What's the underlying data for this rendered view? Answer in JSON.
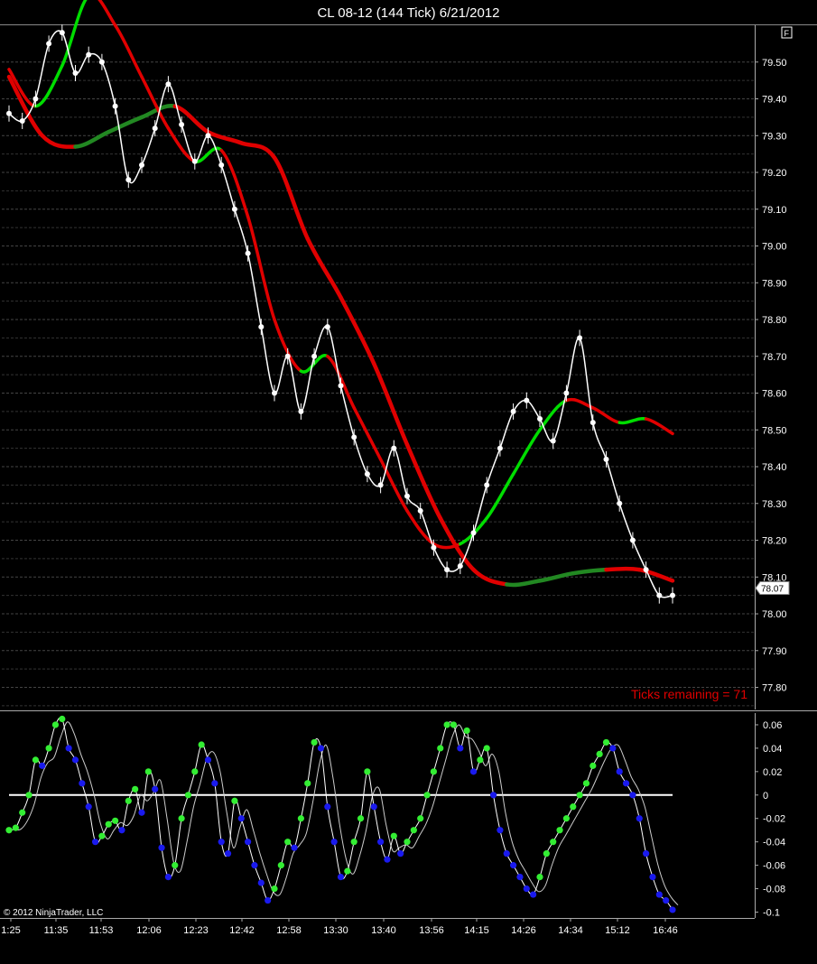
{
  "title": "CL 08-12 (144 Tick)  6/21/2012",
  "flag_label": "F",
  "copyright": "© 2012 NinjaTrader, LLC",
  "ticks_remaining": "Ticks remaining = 71",
  "last_price_label": "78.07",
  "colors": {
    "background": "#000000",
    "price": "#ffffff",
    "ma_red": "#e00000",
    "ma_green": "#00dd00",
    "ma_darkgreen": "#228822",
    "osc_green": "#33ee33",
    "osc_blue": "#1a1aee",
    "zero_line": "#ffffff",
    "ticks_text": "#e00000"
  },
  "chart_data": [
    {
      "type": "line",
      "title": "CL 08-12 (144 Tick)  6/21/2012",
      "y_axis_side": "right",
      "ylim": [
        77.74,
        79.6
      ],
      "yticks": [
        "79.50",
        "79.40",
        "79.30",
        "79.20",
        "79.10",
        "79.00",
        "78.90",
        "78.80",
        "78.70",
        "78.60",
        "78.50",
        "78.40",
        "78.30",
        "78.20",
        "78.10",
        "78.00",
        "77.90",
        "77.80"
      ],
      "ytick_values": [
        79.5,
        79.4,
        79.3,
        79.2,
        79.1,
        79.0,
        78.9,
        78.8,
        78.7,
        78.6,
        78.5,
        78.4,
        78.3,
        78.2,
        78.1,
        78.0,
        77.9,
        77.8
      ],
      "last_price": 78.07,
      "series": [
        {
          "style": "price",
          "x": [
            0,
            2,
            4,
            6,
            8,
            10,
            12,
            14,
            16,
            18,
            20,
            22,
            24,
            26,
            28,
            30,
            32,
            34,
            36,
            38,
            40,
            42,
            44,
            46,
            48,
            50,
            52,
            54,
            56,
            58,
            60,
            62,
            64,
            66,
            68,
            70,
            72,
            74,
            76,
            78,
            80,
            82,
            84,
            86,
            88,
            90,
            92,
            94,
            96,
            98,
            100
          ],
          "values": [
            79.36,
            79.34,
            79.4,
            79.55,
            79.58,
            79.47,
            79.52,
            79.5,
            79.38,
            79.18,
            79.22,
            79.32,
            79.44,
            79.33,
            79.23,
            79.3,
            79.22,
            79.1,
            78.98,
            78.78,
            78.6,
            78.7,
            78.55,
            78.7,
            78.78,
            78.62,
            78.48,
            78.38,
            78.35,
            78.45,
            78.32,
            78.28,
            78.18,
            78.12,
            78.13,
            78.22,
            78.35,
            78.45,
            78.55,
            78.58,
            78.53,
            78.47,
            78.6,
            78.75,
            78.52,
            78.42,
            78.3,
            78.2,
            78.12,
            78.05,
            78.05
          ]
        },
        {
          "style": "ma-fast",
          "x": [
            0,
            4,
            8,
            12,
            16,
            20,
            24,
            28,
            32,
            36,
            40,
            44,
            48,
            52,
            56,
            60,
            64,
            68,
            72,
            76,
            80,
            84,
            88,
            92,
            96,
            100
          ],
          "values": [
            79.48,
            79.38,
            79.49,
            79.68,
            79.6,
            79.46,
            79.32,
            79.23,
            79.26,
            79.08,
            78.8,
            78.66,
            78.7,
            78.56,
            78.42,
            78.28,
            78.19,
            78.19,
            78.26,
            78.38,
            78.5,
            78.58,
            78.56,
            78.52,
            78.53,
            78.49
          ]
        },
        {
          "style": "ma-slow",
          "x": [
            0,
            5,
            10,
            15,
            20,
            25,
            30,
            35,
            40,
            45,
            50,
            55,
            60,
            65,
            70,
            75,
            80,
            85,
            90,
            95,
            100
          ],
          "values": [
            79.46,
            79.3,
            79.27,
            79.31,
            79.35,
            79.38,
            79.31,
            79.28,
            79.24,
            79.02,
            78.86,
            78.68,
            78.46,
            78.26,
            78.12,
            78.08,
            78.09,
            78.11,
            78.12,
            78.12,
            78.09
          ]
        }
      ],
      "annotations": [
        "Ticks remaining = 71"
      ]
    },
    {
      "type": "scatter",
      "ylim": [
        -0.105,
        0.07
      ],
      "yticks": [
        "0.06",
        "0.04",
        "0.02",
        "0",
        "-0.02",
        "-0.04",
        "-0.06",
        "-0.08",
        "-0.1"
      ],
      "ytick_values": [
        0.06,
        0.04,
        0.02,
        0,
        -0.02,
        -0.04,
        -0.06,
        -0.08,
        -0.1
      ],
      "zero_line": 0,
      "x_axis": {
        "tick_labels": [
          "1:25",
          "11:35",
          "11:53",
          "12:06",
          "12:23",
          "12:42",
          "12:58",
          "13:30",
          "13:40",
          "13:56",
          "14:15",
          "14:26",
          "14:34",
          "15:12",
          "16:46"
        ]
      },
      "series": [
        {
          "style": "oscillator",
          "x": [
            0,
            1,
            2,
            3,
            4,
            5,
            6,
            7,
            8,
            9,
            10,
            11,
            12,
            13,
            14,
            15,
            16,
            17,
            18,
            19,
            20,
            21,
            22,
            23,
            24,
            25,
            26,
            27,
            28,
            29,
            30,
            31,
            32,
            33,
            34,
            35,
            36,
            37,
            38,
            39,
            40,
            41,
            42,
            43,
            44,
            45,
            46,
            47,
            48,
            49,
            50,
            51,
            52,
            53,
            54,
            55,
            56,
            57,
            58,
            59,
            60,
            61,
            62,
            63,
            64,
            65,
            66,
            67,
            68,
            69,
            70,
            71,
            72,
            73,
            74,
            75,
            76,
            77,
            78,
            79,
            80,
            81,
            82,
            83,
            84,
            85,
            86,
            87,
            88,
            89,
            90,
            91,
            92,
            93,
            94,
            95,
            96,
            97,
            98,
            99,
            100
          ],
          "values": [
            -0.03,
            -0.028,
            -0.015,
            0.0,
            0.03,
            0.025,
            0.04,
            0.06,
            0.065,
            0.04,
            0.03,
            0.01,
            -0.01,
            -0.04,
            -0.035,
            -0.025,
            -0.022,
            -0.03,
            -0.005,
            0.005,
            -0.015,
            0.02,
            0.005,
            -0.045,
            -0.07,
            -0.06,
            -0.02,
            0.0,
            0.02,
            0.043,
            0.03,
            0.01,
            -0.04,
            -0.05,
            -0.005,
            -0.02,
            -0.04,
            -0.06,
            -0.075,
            -0.09,
            -0.08,
            -0.06,
            -0.04,
            -0.045,
            -0.02,
            0.01,
            0.045,
            0.04,
            -0.01,
            -0.04,
            -0.07,
            -0.065,
            -0.04,
            -0.02,
            0.02,
            -0.01,
            -0.04,
            -0.055,
            -0.035,
            -0.05,
            -0.04,
            -0.03,
            -0.02,
            0.0,
            0.02,
            0.04,
            0.06,
            0.06,
            0.04,
            0.055,
            0.02,
            0.03,
            0.04,
            0.0,
            -0.03,
            -0.05,
            -0.06,
            -0.07,
            -0.08,
            -0.085,
            -0.07,
            -0.05,
            -0.04,
            -0.03,
            -0.02,
            -0.01,
            0.0,
            0.01,
            0.025,
            0.035,
            0.045,
            0.04,
            0.02,
            0.01,
            0.0,
            -0.02,
            -0.05,
            -0.07,
            -0.085,
            -0.09,
            -0.098
          ]
        }
      ]
    }
  ]
}
